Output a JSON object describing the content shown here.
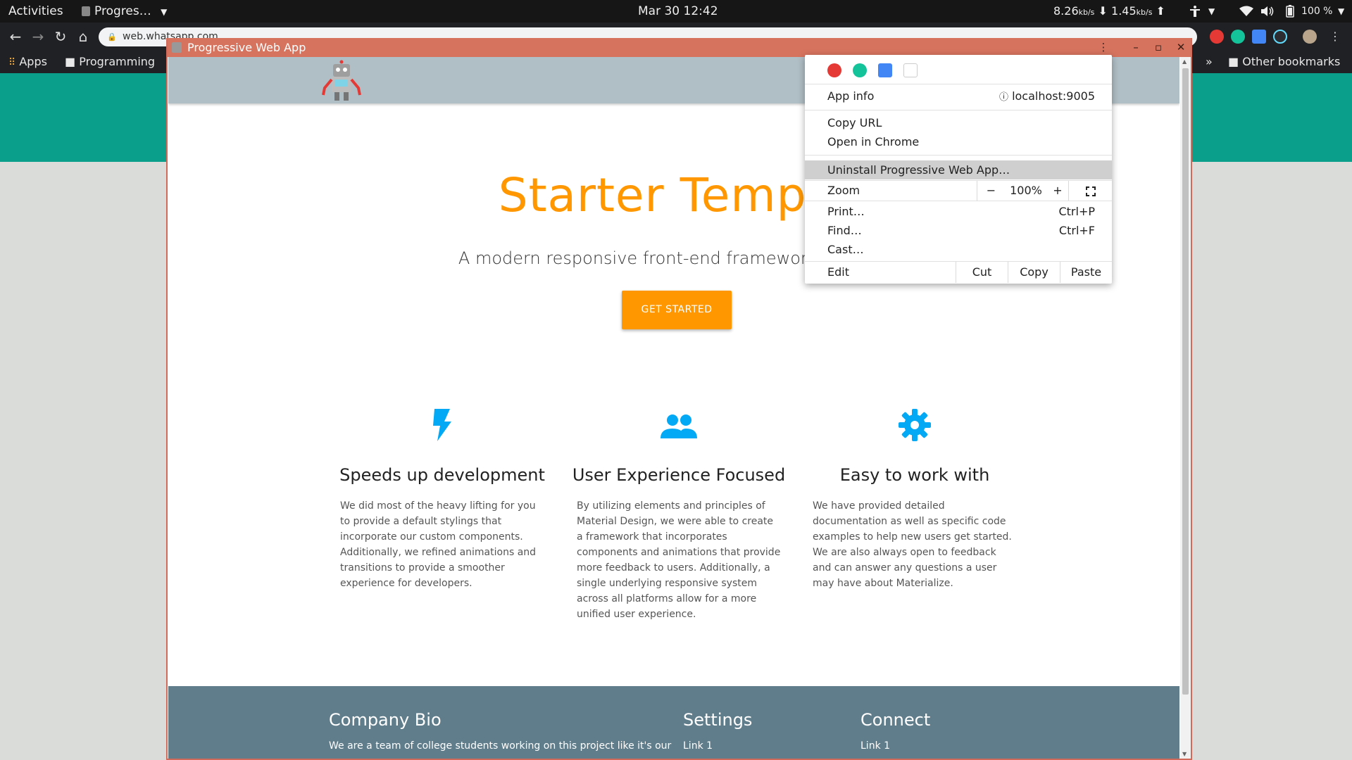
{
  "topbar": {
    "activities": "Activities",
    "app_menu": "Progres…",
    "datetime": "Mar 30  12:42",
    "net_down": "8.26",
    "net_down_unit": "kb/s",
    "net_up": "1.45",
    "net_up_unit": "kb/s",
    "battery": "100 %"
  },
  "browser": {
    "url": "web.whatsapp.com",
    "bookmarks": {
      "apps": "Apps",
      "programming": "Programming",
      "other": "Other bookmarks",
      "overflow": "»"
    }
  },
  "pwa_window": {
    "title": "Progressive Web App"
  },
  "site": {
    "hero_title": "Starter Templa",
    "hero_subtitle": "A modern responsive front-end framework based o",
    "cta": "GET STARTED",
    "features": [
      {
        "icon": "flash-icon",
        "title": "Speeds up development",
        "text": "We did most of the heavy lifting for you to provide a default stylings that incorporate our custom components. Additionally, we refined animations and transitions to provide a smoother experience for developers."
      },
      {
        "icon": "group-icon",
        "title": "User Experience Focused",
        "text": "By utilizing elements and principles of Material Design, we were able to create a framework that incorporates components and animations that provide more feedback to users. Additionally, a single underlying responsive system across all platforms allow for a more unified user experience."
      },
      {
        "icon": "settings-icon",
        "title": "Easy to work with",
        "text": "We have provided detailed documentation as well as specific code examples to help new users get started. We are also always open to feedback and can answer any questions a user may have about Materialize."
      }
    ],
    "footer": {
      "bio_title": "Company Bio",
      "bio_text": "We are a team of college students working on this project like it's our",
      "settings_title": "Settings",
      "settings_link": "Link 1",
      "connect_title": "Connect",
      "connect_link": "Link 1"
    }
  },
  "menu": {
    "app_info": "App info",
    "origin": "localhost:9005",
    "copy_url": "Copy URL",
    "open_in_chrome": "Open in Chrome",
    "uninstall": "Uninstall Progressive Web App…",
    "zoom": "Zoom",
    "zoom_minus": "−",
    "zoom_level": "100%",
    "zoom_plus": "+",
    "print": "Print…",
    "print_shortcut": "Ctrl+P",
    "find": "Find…",
    "find_shortcut": "Ctrl+F",
    "cast": "Cast…",
    "edit": "Edit",
    "cut": "Cut",
    "copy": "Copy",
    "paste": "Paste"
  },
  "colors": {
    "accent_orange": "#ff9800",
    "titlebar": "#d5735e",
    "teal": "#0a9f8a",
    "footer": "#607d8b",
    "icon_blue": "#03a9f4"
  }
}
